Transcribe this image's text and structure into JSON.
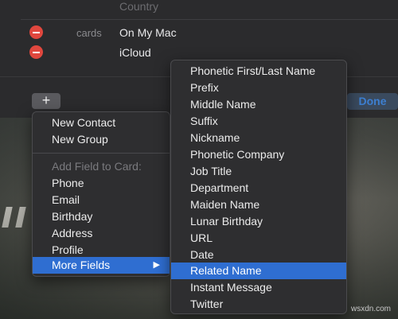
{
  "top": {
    "country_label": "Country",
    "rows": [
      {
        "label": "cards",
        "value": "On My Mac"
      },
      {
        "label": "",
        "value": "iCloud"
      }
    ]
  },
  "toolbar": {
    "add_label": "+",
    "done_label": "Done"
  },
  "main_menu": {
    "items": [
      "New Contact",
      "New Group"
    ],
    "section_header": "Add Field to Card:",
    "fields": [
      "Phone",
      "Email",
      "Birthday",
      "Address",
      "Profile"
    ],
    "more_fields": "More Fields",
    "arrow": "▶"
  },
  "submenu": {
    "items": [
      "Phonetic First/Last Name",
      "Prefix",
      "Middle Name",
      "Suffix",
      "Nickname",
      "Phonetic Company",
      "Job Title",
      "Department",
      "Maiden Name",
      "Lunar Birthday",
      "URL",
      "Date",
      "Related Name",
      "Instant Message",
      "Twitter"
    ],
    "selected": "Related Name"
  },
  "watermark": "wsxdn.com",
  "colors": {
    "accent": "#2f6ed1",
    "remove": "#e0473e",
    "done_text": "#3d7fd1"
  }
}
